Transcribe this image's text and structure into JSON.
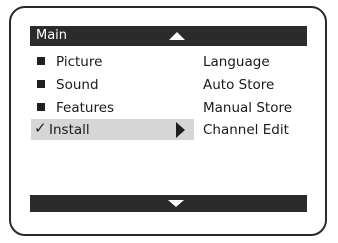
{
  "header": {
    "title": "Main"
  },
  "menu": {
    "items": [
      {
        "label": "Picture",
        "selected": false
      },
      {
        "label": "Sound",
        "selected": false
      },
      {
        "label": "Features",
        "selected": false
      },
      {
        "label": "Install",
        "selected": true
      }
    ]
  },
  "submenu": {
    "items": [
      {
        "label": "Language"
      },
      {
        "label": "Auto Store"
      },
      {
        "label": "Manual Store"
      },
      {
        "label": "Channel Edit"
      }
    ]
  },
  "icons": {
    "scroll_up": "up-triangle-icon",
    "scroll_down": "down-triangle-icon",
    "selected_mark": "checkmark-icon",
    "submenu_indicator": "right-triangle-icon",
    "item_bullet": "square-bullet-icon"
  },
  "colors": {
    "bar": "#2b2b2b",
    "selected_row": "#d6d6d6",
    "frame": "#2a2a2a"
  }
}
